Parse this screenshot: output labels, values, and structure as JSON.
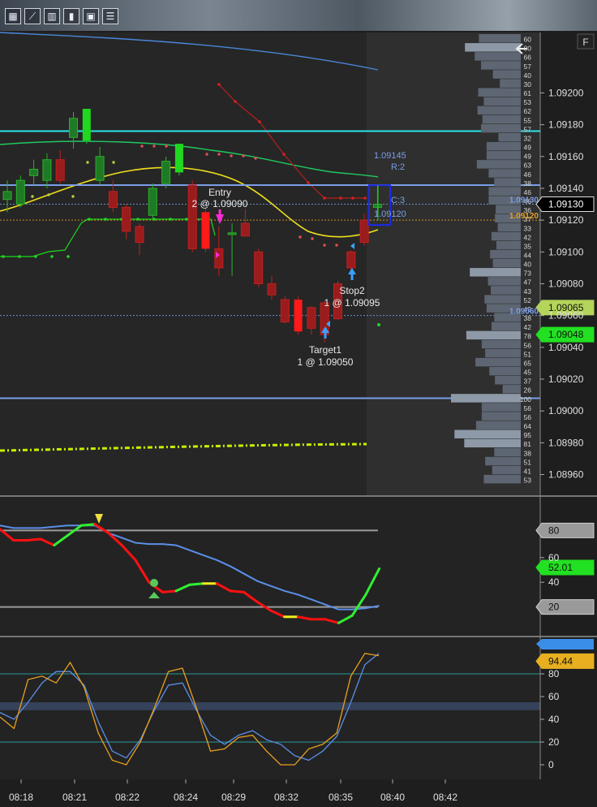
{
  "toolbar": {
    "icons": [
      "grid-icon",
      "line-chart-icon",
      "bar-chart-icon",
      "candlestick-icon",
      "image-icon",
      "list-icon"
    ],
    "glyphs": [
      "▦",
      "⟋",
      "▥",
      "▮",
      "▣",
      "☰"
    ]
  },
  "colors": {
    "bg": "#1e1e1e",
    "shade": "#2b2b2b",
    "bull": "#1fd81f",
    "bear": "#e02020",
    "cyan": "#29e5e8",
    "blue_line": "#7a9ee8",
    "yellow": "#f0e01e",
    "green_ma": "#20c860",
    "lime_dash": "#c8f000",
    "stoch_blue": "#5b8fe8",
    "stoch_orange": "#e8a020"
  },
  "chart_data": [
    {
      "type": "candlestick",
      "title": "",
      "x_ticks": [
        "08:18",
        "08:21",
        "08:22",
        "08:24",
        "08:29",
        "08:32",
        "08:35",
        "08:40",
        "08:42"
      ],
      "y_ticks": [
        1.092,
        1.0918,
        1.0916,
        1.0914,
        1.0912,
        1.091,
        1.0908,
        1.0906,
        1.0904,
        1.0902,
        1.09,
        1.0898,
        1.0896
      ],
      "y_tick_labels": [
        "1.09200",
        "1.09180",
        "1.09160",
        "1.09140",
        "1.09120",
        "1.09100",
        "1.09080",
        "1.09060",
        "1.09040",
        "1.09020",
        "1.09000",
        "1.08980",
        "1.08960"
      ],
      "ylim": [
        1.08947,
        1.09238
      ],
      "candles": [
        {
          "o": 1.09133,
          "h": 1.09145,
          "l": 1.09125,
          "c": 1.09138
        },
        {
          "o": 1.0913,
          "h": 1.09148,
          "l": 1.09128,
          "c": 1.09145
        },
        {
          "o": 1.09148,
          "h": 1.09158,
          "l": 1.09142,
          "c": 1.09152
        },
        {
          "o": 1.09145,
          "h": 1.09162,
          "l": 1.0914,
          "c": 1.09158
        },
        {
          "o": 1.09158,
          "h": 1.09164,
          "l": 1.09143,
          "c": 1.09145
        },
        {
          "o": 1.09172,
          "h": 1.09188,
          "l": 1.09165,
          "c": 1.09184
        },
        {
          "o": 1.0917,
          "h": 1.0919,
          "l": 1.09168,
          "c": 1.0919
        },
        {
          "o": 1.09145,
          "h": 1.09166,
          "l": 1.09142,
          "c": 1.0916
        },
        {
          "o": 1.09138,
          "h": 1.09145,
          "l": 1.09125,
          "c": 1.09128
        },
        {
          "o": 1.09128,
          "h": 1.0913,
          "l": 1.09108,
          "c": 1.09113
        },
        {
          "o": 1.09116,
          "h": 1.09118,
          "l": 1.09098,
          "c": 1.09106
        },
        {
          "o": 1.09123,
          "h": 1.09143,
          "l": 1.0912,
          "c": 1.0914
        },
        {
          "o": 1.09143,
          "h": 1.0916,
          "l": 1.0914,
          "c": 1.09157
        },
        {
          "o": 1.0915,
          "h": 1.09168,
          "l": 1.09148,
          "c": 1.09168
        },
        {
          "o": 1.09142,
          "h": 1.09145,
          "l": 1.091,
          "c": 1.09102
        },
        {
          "o": 1.09125,
          "h": 1.09128,
          "l": 1.091,
          "c": 1.09102
        },
        {
          "o": 1.09102,
          "h": 1.09116,
          "l": 1.09085,
          "c": 1.0909
        },
        {
          "o": 1.09112,
          "h": 1.09118,
          "l": 1.09085,
          "c": 1.09112
        },
        {
          "o": 1.09118,
          "h": 1.09127,
          "l": 1.0911,
          "c": 1.0911
        },
        {
          "o": 1.091,
          "h": 1.09102,
          "l": 1.09078,
          "c": 1.0908
        },
        {
          "o": 1.0908,
          "h": 1.09085,
          "l": 1.0907,
          "c": 1.09073
        },
        {
          "o": 1.0907,
          "h": 1.09072,
          "l": 1.09055,
          "c": 1.09056
        },
        {
          "o": 1.0907,
          "h": 1.09072,
          "l": 1.09048,
          "c": 1.0905
        },
        {
          "o": 1.09065,
          "h": 1.09066,
          "l": 1.09048,
          "c": 1.09052
        },
        {
          "o": 1.09068,
          "h": 1.09069,
          "l": 1.09043,
          "c": 1.09048
        },
        {
          "o": 1.0908,
          "h": 1.09082,
          "l": 1.09057,
          "c": 1.09058
        },
        {
          "o": 1.091,
          "h": 1.09101,
          "l": 1.09088,
          "c": 1.0909
        },
        {
          "o": 1.0912,
          "h": 1.09124,
          "l": 1.09104,
          "c": 1.09106
        },
        {
          "o": 1.09128,
          "h": 1.09142,
          "l": 1.09122,
          "c": 1.0913
        }
      ],
      "highlight_candles": [
        6,
        13,
        15,
        22
      ],
      "horizontal_lines": [
        {
          "y": 1.09176,
          "color": "cyan"
        },
        {
          "y": 1.09142,
          "color": "blue_line"
        },
        {
          "y": 1.09008,
          "color": "blue_line"
        }
      ],
      "dotted_lines": [
        {
          "y": 1.0913,
          "color": "blue_line"
        },
        {
          "y": 1.0912,
          "color": "stoch_orange"
        },
        {
          "y": 1.0906,
          "color": "blue_line"
        }
      ],
      "price_tags": [
        {
          "text": "1.09130",
          "y": 1.0913,
          "style": "black"
        },
        {
          "text": "1.09065",
          "y": 1.09065,
          "style": "olive"
        },
        {
          "text": "1.09048",
          "y": 1.09048,
          "style": "green"
        }
      ],
      "line_labels": [
        {
          "text": "1.09130",
          "y": 1.0913,
          "color": "blue_line"
        },
        {
          "text": "1.09120",
          "y": 1.0912,
          "color": "stoch_orange"
        },
        {
          "text": "1.09060",
          "y": 1.0906,
          "color": "blue_line"
        }
      ],
      "annotations": {
        "entry": [
          "Entry",
          "2 @ 1.09090"
        ],
        "stop": [
          "Stop2",
          "1 @ 1.09095"
        ],
        "target": [
          "Target1",
          "1 @ 1.09050"
        ],
        "box_high": "1.09145",
        "box_low": "1.09120",
        "r_label": "R:2",
        "c_label": "C:3"
      },
      "volume_profile": {
        "labels": [
          "60",
          "80",
          "66",
          "57",
          "40",
          "30",
          "61",
          "53",
          "62",
          "55",
          "57",
          "32",
          "49",
          "49",
          "63",
          "46",
          "38",
          "46",
          "46",
          "36",
          "37",
          "33",
          "42",
          "35",
          "44",
          "40",
          "73",
          "47",
          "43",
          "52",
          "49",
          "38",
          "42",
          "78",
          "56",
          "51",
          "65",
          "45",
          "37",
          "26",
          "100",
          "56",
          "56",
          "64",
          "95",
          "81",
          "38",
          "51",
          "41",
          "53"
        ]
      },
      "corner_label": "F"
    },
    {
      "type": "line",
      "title": "",
      "y_ticks": [
        80,
        60,
        40,
        20
      ],
      "ylim": [
        0,
        100
      ],
      "levels": [
        82,
        20
      ],
      "tags": [
        {
          "text": "80",
          "y": 82,
          "style": "gray"
        },
        {
          "text": "52.01",
          "y": 52,
          "style": "green"
        },
        {
          "text": "20",
          "y": 20,
          "style": "gray"
        }
      ],
      "series": [
        {
          "values": [
            86,
            84,
            84,
            84,
            85,
            86,
            86,
            86,
            80,
            76,
            72,
            71,
            71,
            70,
            66,
            62,
            58,
            53,
            47,
            41,
            37,
            33,
            30,
            26,
            22,
            18,
            18,
            19,
            21
          ]
        },
        {
          "values": [
            83,
            74,
            74,
            75,
            70,
            78,
            86,
            87,
            80,
            70,
            58,
            40,
            32,
            33,
            38,
            39,
            39,
            33,
            32,
            24,
            17,
            12,
            12,
            10,
            10,
            7,
            13,
            30,
            51
          ],
          "colors": [
            "red",
            "red",
            "red",
            "red",
            "green",
            "green",
            "green",
            "red",
            "red",
            "red",
            "red",
            "red",
            "red",
            "green",
            "green",
            "yellow",
            "red",
            "red",
            "red",
            "red",
            "red",
            "yellow",
            "red",
            "red",
            "red",
            "green",
            "green",
            "green"
          ]
        }
      ]
    },
    {
      "type": "line",
      "title": "",
      "y_ticks": [
        80,
        60,
        40,
        20,
        0
      ],
      "ylim": [
        -10,
        105
      ],
      "levels": [
        80,
        20
      ],
      "band": [
        48,
        55
      ],
      "tags": [
        {
          "text": "94.44",
          "y": 94,
          "style": "orange"
        }
      ],
      "series": [
        {
          "color": "stoch_blue",
          "values": [
            46,
            40,
            55,
            72,
            82,
            82,
            70,
            38,
            12,
            6,
            22,
            48,
            70,
            72,
            48,
            26,
            18,
            26,
            30,
            22,
            18,
            8,
            4,
            12,
            25,
            55,
            88,
            98
          ]
        },
        {
          "color": "stoch_orange",
          "values": [
            42,
            32,
            75,
            78,
            72,
            90,
            68,
            28,
            4,
            0,
            20,
            50,
            82,
            85,
            50,
            12,
            14,
            24,
            26,
            12,
            0,
            0,
            14,
            18,
            28,
            78,
            98,
            96
          ]
        }
      ]
    }
  ]
}
